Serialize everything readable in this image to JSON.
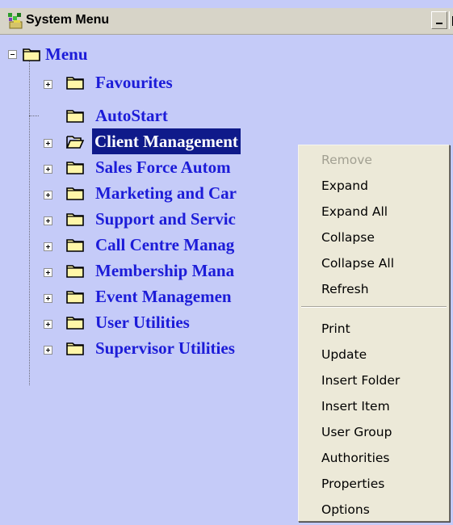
{
  "window": {
    "title": "System Menu",
    "app_icon": "system-menu-app-icon"
  },
  "tree": {
    "root": {
      "label": "Menu",
      "expanded": true
    },
    "items": [
      {
        "label": "Favourites",
        "has_children": true
      },
      {
        "label": "AutoStart",
        "has_children": false
      },
      {
        "label": "Client Management",
        "has_children": true,
        "selected": true,
        "folder_open": true
      },
      {
        "label": "Sales Force Autom",
        "has_children": true
      },
      {
        "label": "Marketing and Car",
        "has_children": true
      },
      {
        "label": "Support and Servic",
        "has_children": true
      },
      {
        "label": "Call Centre Manag",
        "has_children": true
      },
      {
        "label": "Membership Mana",
        "has_children": true
      },
      {
        "label": "Event Managemen",
        "has_children": true
      },
      {
        "label": "User Utilities",
        "has_children": true
      },
      {
        "label": "Supervisor Utilities",
        "has_children": true
      }
    ]
  },
  "context_menu": {
    "group1": [
      {
        "label": "Remove",
        "enabled": false
      },
      {
        "label": "Expand",
        "enabled": true
      },
      {
        "label": "Expand All",
        "enabled": true
      },
      {
        "label": "Collapse",
        "enabled": true
      },
      {
        "label": "Collapse All",
        "enabled": true
      },
      {
        "label": "Refresh",
        "enabled": true
      }
    ],
    "group2": [
      {
        "label": "Print",
        "enabled": true
      },
      {
        "label": "Update",
        "enabled": true
      },
      {
        "label": "Insert Folder",
        "enabled": true
      },
      {
        "label": "Insert Item",
        "enabled": true
      },
      {
        "label": "User Group",
        "enabled": true
      },
      {
        "label": "Authorities",
        "enabled": true
      },
      {
        "label": "Properties",
        "enabled": true
      },
      {
        "label": "Options",
        "enabled": true
      }
    ]
  },
  "colors": {
    "background": "#c5cbf8",
    "tree_text": "#1c1cd8",
    "selection": "#0f1a8a",
    "menu_bg": "#ece9d8",
    "disabled_text": "#a2a092"
  }
}
